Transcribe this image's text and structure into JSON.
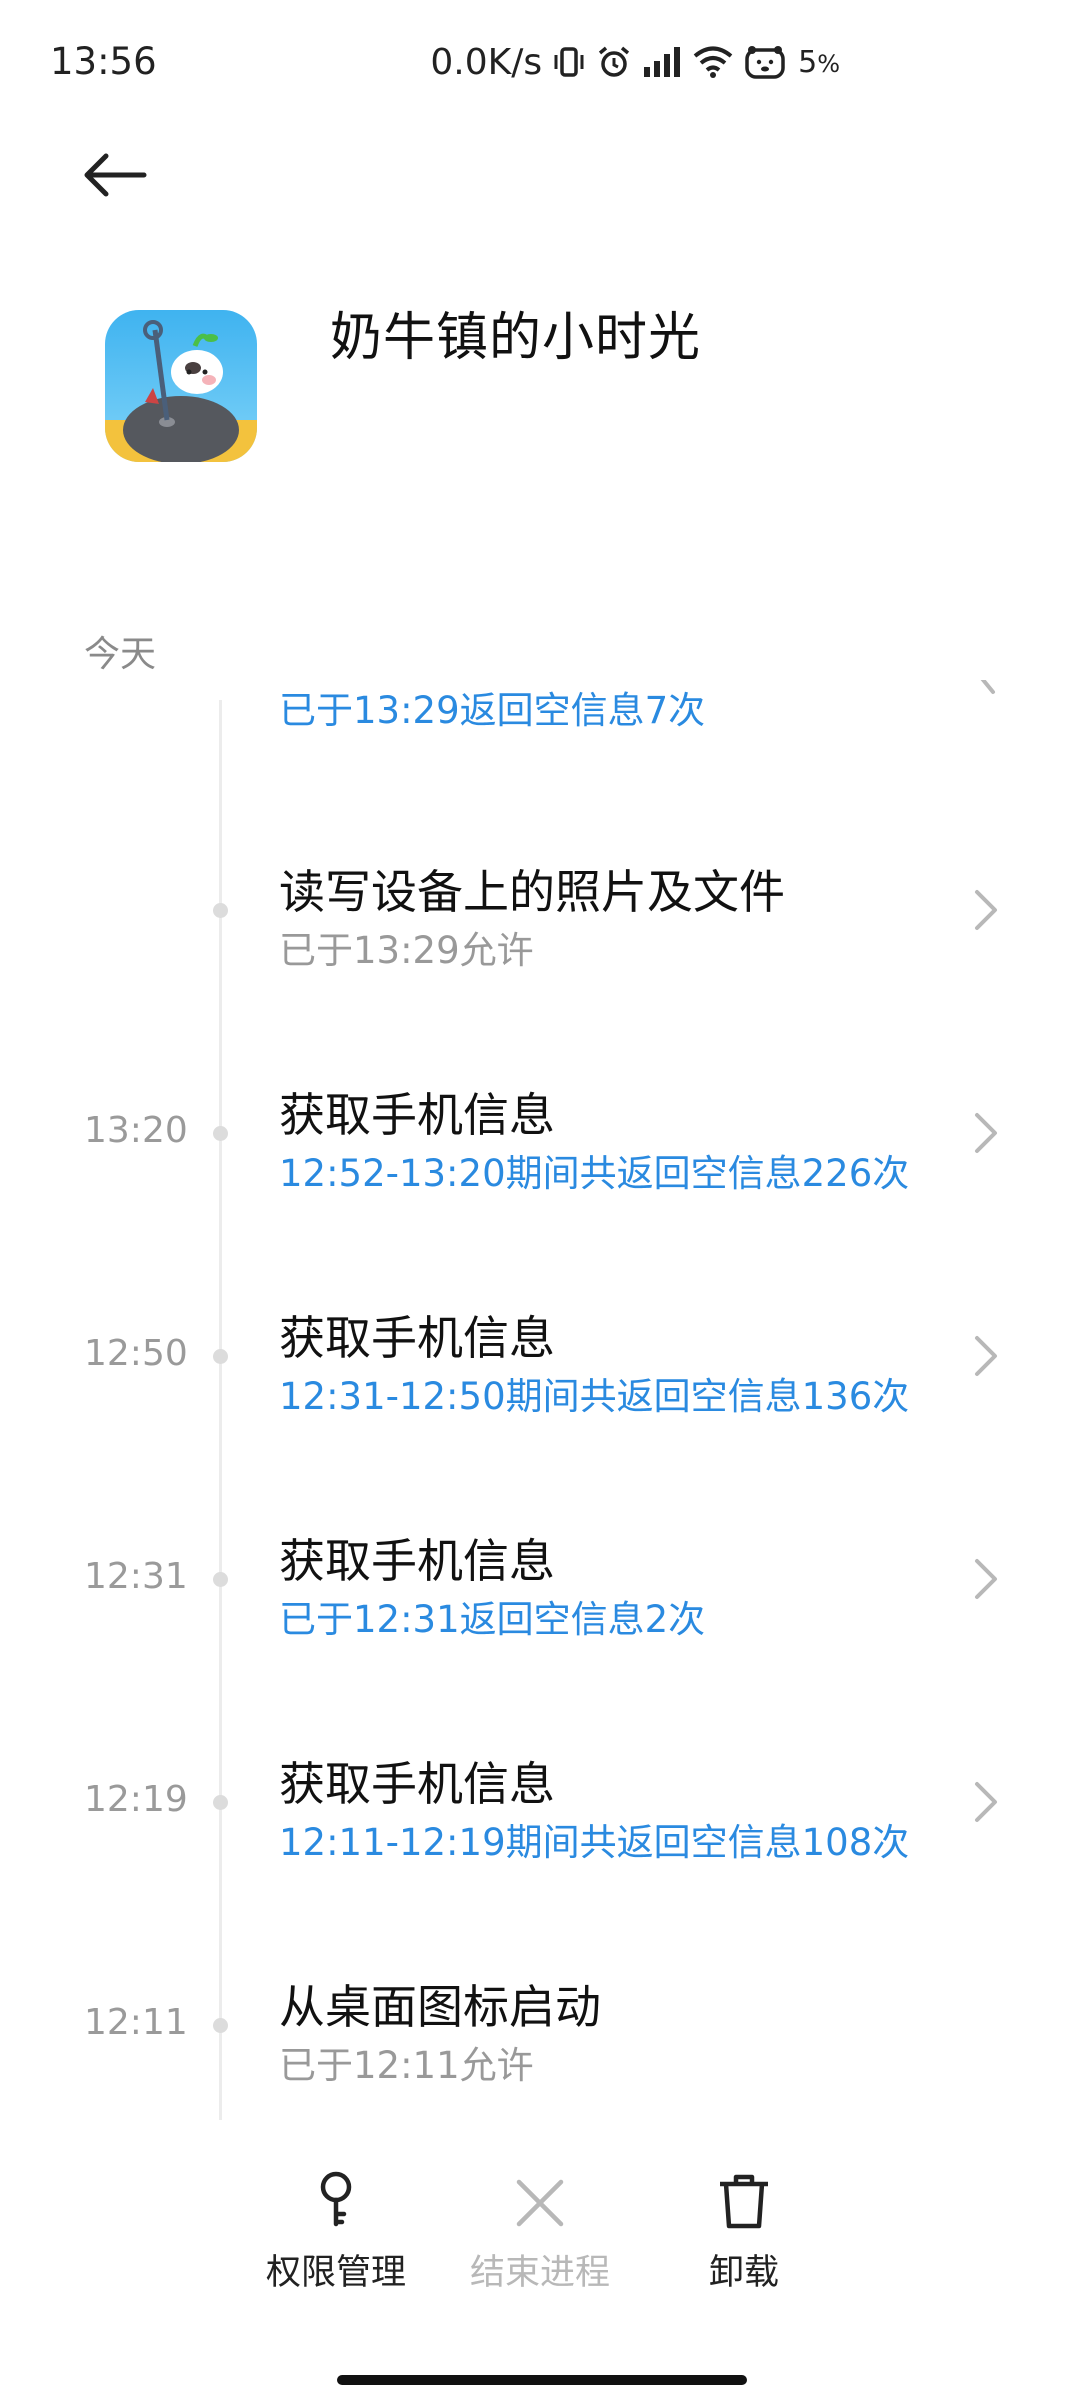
{
  "status_bar": {
    "time": "13:56",
    "net_speed": "0.0K/s",
    "battery_percent": "5",
    "battery_unit": "%",
    "icons": [
      "vibrate-icon",
      "alarm-icon",
      "signal-icon",
      "wifi-icon",
      "battery-face-icon"
    ]
  },
  "header": {
    "back_icon": "arrow-left-icon",
    "app_name": "奶牛镇的小时光"
  },
  "timeline": {
    "section_label": "今天",
    "items": [
      {
        "time": "",
        "title": "",
        "subtitle": "已于13:29返回空信息7次",
        "subtitle_color": "#2a8ae0",
        "has_chevron": true
      },
      {
        "time": "",
        "title": "读写设备上的照片及文件",
        "subtitle": "已于13:29允许",
        "subtitle_color": "#999999",
        "has_chevron": true
      },
      {
        "time": "13:20",
        "title": "获取手机信息",
        "subtitle": "12:52-13:20期间共返回空信息226次",
        "subtitle_color": "#2a8ae0",
        "has_chevron": true
      },
      {
        "time": "12:50",
        "title": "获取手机信息",
        "subtitle": "12:31-12:50期间共返回空信息136次",
        "subtitle_color": "#2a8ae0",
        "has_chevron": true
      },
      {
        "time": "12:31",
        "title": "获取手机信息",
        "subtitle": "已于12:31返回空信息2次",
        "subtitle_color": "#2a8ae0",
        "has_chevron": true
      },
      {
        "time": "12:19",
        "title": "获取手机信息",
        "subtitle": "12:11-12:19期间共返回空信息108次",
        "subtitle_color": "#2a8ae0",
        "has_chevron": true
      },
      {
        "time": "12:11",
        "title": "从桌面图标启动",
        "subtitle": "已于12:11允许",
        "subtitle_color": "#999999",
        "has_chevron": false
      }
    ]
  },
  "bottom_bar": {
    "permissions_label": "权限管理",
    "end_process_label": "结束进程",
    "uninstall_label": "卸载"
  }
}
